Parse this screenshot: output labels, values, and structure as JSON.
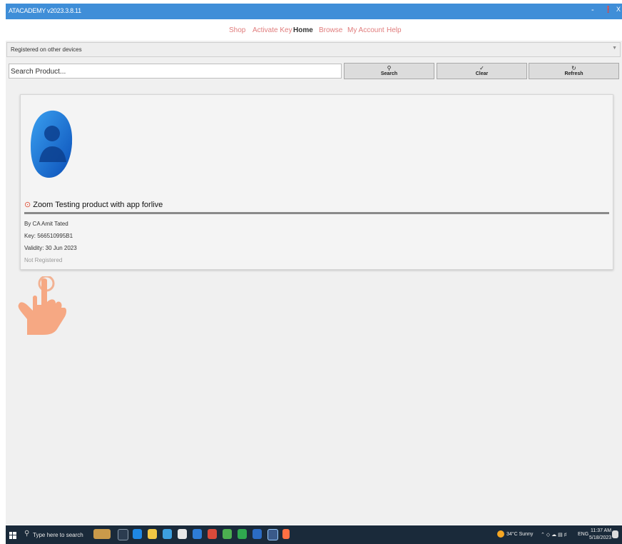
{
  "window": {
    "title": "ATACADEMY v2023.3.8.11",
    "controls": [
      "-",
      "❗",
      "X"
    ]
  },
  "menu": [
    {
      "label": "Shop",
      "active": false
    },
    {
      "label": "Activate Key",
      "active": false
    },
    {
      "label": "Home",
      "active": true
    },
    {
      "label": "Browse",
      "active": false
    },
    {
      "label": "My Account",
      "active": false
    },
    {
      "label": "Help",
      "active": false
    }
  ],
  "device_select": {
    "value": "Registered on other devices"
  },
  "search": {
    "placeholder": "Search Product..."
  },
  "buttons": {
    "search": "Search",
    "clear": "Clear",
    "refresh": "Refresh"
  },
  "product": {
    "title": "Zoom Testing product with app forlive",
    "by": "By CA Amit Tated",
    "key": "Key: 566510995B1",
    "validity": "Validity: 30 Jun 2023",
    "status": "Not Registered"
  },
  "taskbar": {
    "search_placeholder": "Type here to search",
    "weather": "34°C  Sunny",
    "lang": "ENG",
    "time": "11:37 AM",
    "date": "5/18/2023"
  },
  "colors": {
    "titlebar": "#3f8ed8",
    "menu_text": "#e07c7c",
    "taskbar": "#1a2a3a"
  }
}
